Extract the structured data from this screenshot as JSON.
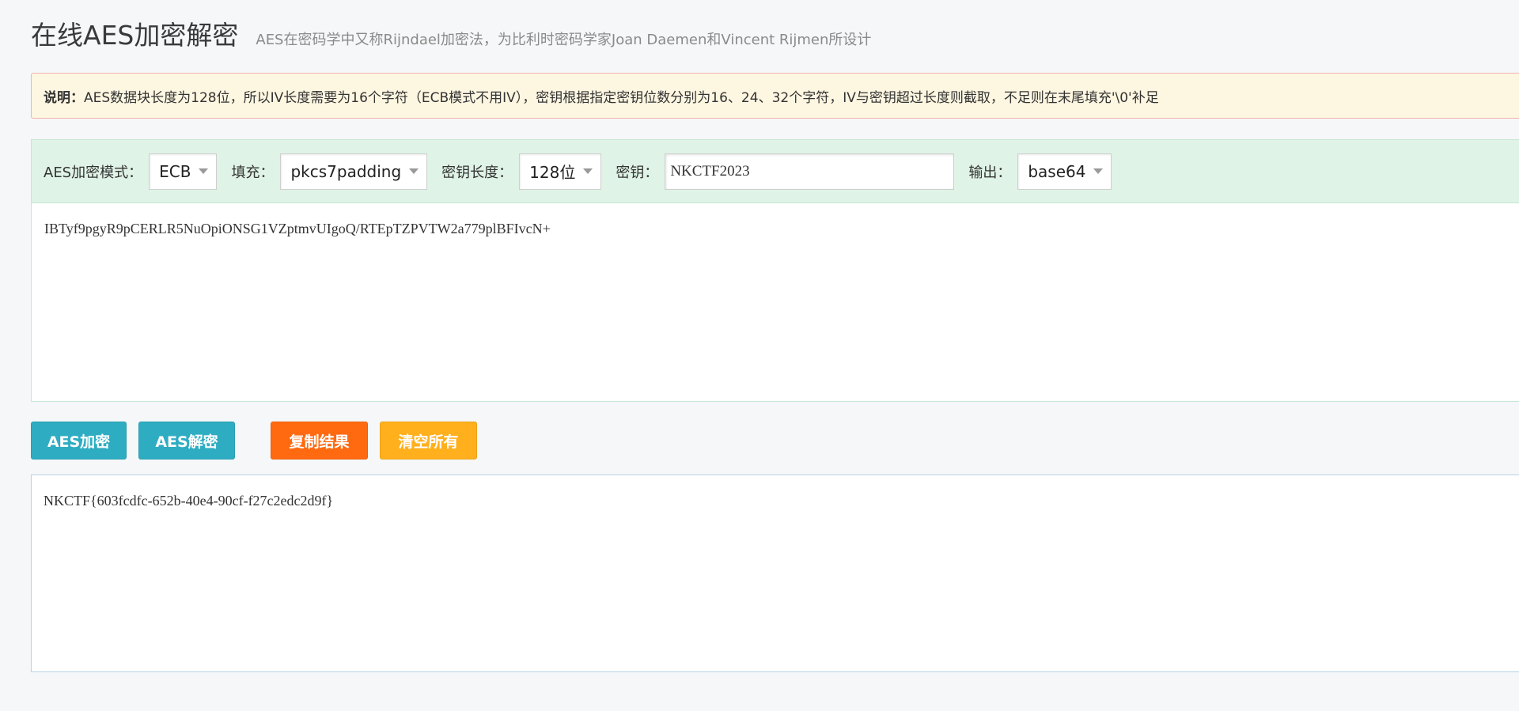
{
  "header": {
    "title": "在线AES加密解密",
    "subtitle": "AES在密码学中又称Rijndael加密法，为比利时密码学家Joan Daemen和Vincent Rijmen所设计"
  },
  "notice": {
    "label": "说明：",
    "text": "AES数据块长度为128位，所以IV长度需要为16个字符（ECB模式不用IV），密钥根据指定密钥位数分别为16、24、32个字符，IV与密钥超过长度则截取，不足则在末尾填充'\\0'补足"
  },
  "options": {
    "mode_label": "AES加密模式：",
    "mode_value": "ECB",
    "padding_label": "填充：",
    "padding_value": "pkcs7padding",
    "keylen_label": "密钥长度：",
    "keylen_value": "128位",
    "key_label": "密钥：",
    "key_value": "NKCTF2023",
    "output_label": "输出：",
    "output_value": "base64"
  },
  "input_text": "IBTyf9pgyR9pCERLR5NuOpiONSG1VZptmvUIgoQ/RTEpTZPVTW2a779plBFIvcN+",
  "buttons": {
    "encrypt": "AES加密",
    "decrypt": "AES解密",
    "copy": "复制结果",
    "clear": "清空所有"
  },
  "output_text": "NKCTF{603fcdfc-652b-40e4-90cf-f27c2edc2d9f}",
  "colors": {
    "teal_button": "#2eadc2",
    "orange_button": "#ff6a10",
    "amber_button": "#ffb01c",
    "notice_bg": "#fdf6e1",
    "options_bg": "#dff3e7"
  }
}
